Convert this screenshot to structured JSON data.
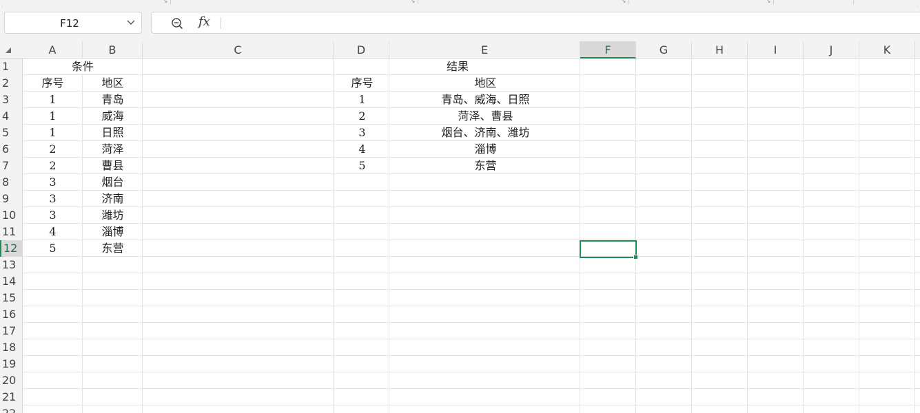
{
  "name_box": {
    "value": "F12"
  },
  "formula_bar": {
    "value": "",
    "fx_label": "fx"
  },
  "columns": [
    "A",
    "B",
    "C",
    "D",
    "E",
    "F",
    "G",
    "H",
    "I",
    "J",
    "K"
  ],
  "rows": [
    "1",
    "2",
    "3",
    "4",
    "5",
    "6",
    "7",
    "8",
    "9",
    "10",
    "11",
    "12",
    "13",
    "14",
    "15",
    "16",
    "17",
    "18",
    "19",
    "20",
    "21",
    "22"
  ],
  "active_cell": "F12",
  "condition_table": {
    "title": "条件",
    "headers": {
      "index": "序号",
      "region": "地区"
    },
    "rows": [
      {
        "index": "1",
        "region": "青岛"
      },
      {
        "index": "1",
        "region": "威海"
      },
      {
        "index": "1",
        "region": "日照"
      },
      {
        "index": "2",
        "region": "菏泽"
      },
      {
        "index": "2",
        "region": "曹县"
      },
      {
        "index": "3",
        "region": "烟台"
      },
      {
        "index": "3",
        "region": "济南"
      },
      {
        "index": "3",
        "region": "潍坊"
      },
      {
        "index": "4",
        "region": "淄博"
      },
      {
        "index": "5",
        "region": "东营"
      }
    ]
  },
  "result_table": {
    "title": "结果",
    "headers": {
      "index": "序号",
      "region": "地区"
    },
    "rows": [
      {
        "index": "1",
        "region": "青岛、威海、日照"
      },
      {
        "index": "2",
        "region": "菏泽、曹县"
      },
      {
        "index": "3",
        "region": "烟台、济南、潍坊"
      },
      {
        "index": "4",
        "region": "淄博"
      },
      {
        "index": "5",
        "region": "东营"
      }
    ]
  },
  "colors": {
    "accent": "#1f8a55",
    "header_bg": "#f3f3f3",
    "active_header_bg": "#d9d9d9",
    "gridline": "#e3e3e3"
  }
}
